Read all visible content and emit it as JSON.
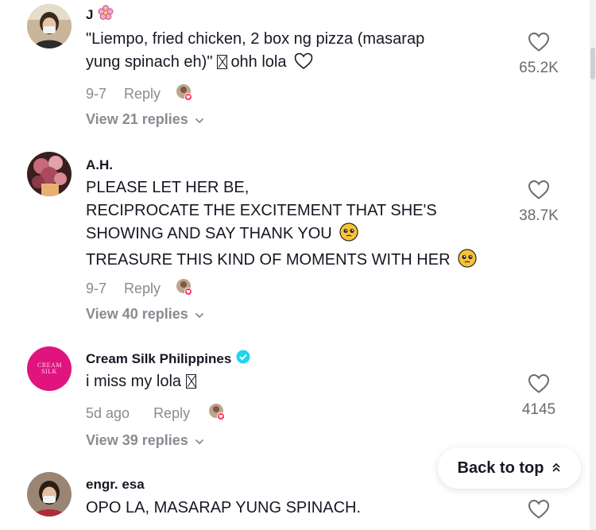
{
  "comments": [
    {
      "username": "J",
      "username_emoji": "flower-icon",
      "line1": "\"Liempo, fried chicken, 2 box ng pizza (masarap",
      "line2": "yung spinach eh)\"",
      "line2_tail": "ohh lola",
      "date": "9-7",
      "reply_label": "Reply",
      "likes": "65.2K",
      "view_replies": "View 21 replies"
    },
    {
      "username": "A.H.",
      "line1": "PLEASE LET HER BE,",
      "line2": "RECIPROCATE THE EXCITEMENT THAT SHE'S",
      "line3": "SHOWING AND SAY THANK YOU",
      "line4": "TREASURE THIS KIND OF MOMENTS WITH HER",
      "date": "9-7",
      "reply_label": "Reply",
      "likes": "38.7K",
      "view_replies": "View 40 replies"
    },
    {
      "username": "Cream Silk Philippines",
      "avatar_text": "CREAM SILK",
      "line1": "i miss my lola",
      "date": "5d ago",
      "reply_label": "Reply",
      "likes": "4145",
      "view_replies": "View 39 replies"
    },
    {
      "username": "engr. esa",
      "line1": "OPO LA, MASARAP YUNG SPINACH."
    }
  ],
  "back_to_top": {
    "label": "Back to top"
  },
  "colors": {
    "text": "#161823",
    "secondary": "#8a8b91",
    "verified": "#20d5ec",
    "cream_silk_pink": "#e0147f",
    "emoji_yellow": "#f8c435"
  }
}
